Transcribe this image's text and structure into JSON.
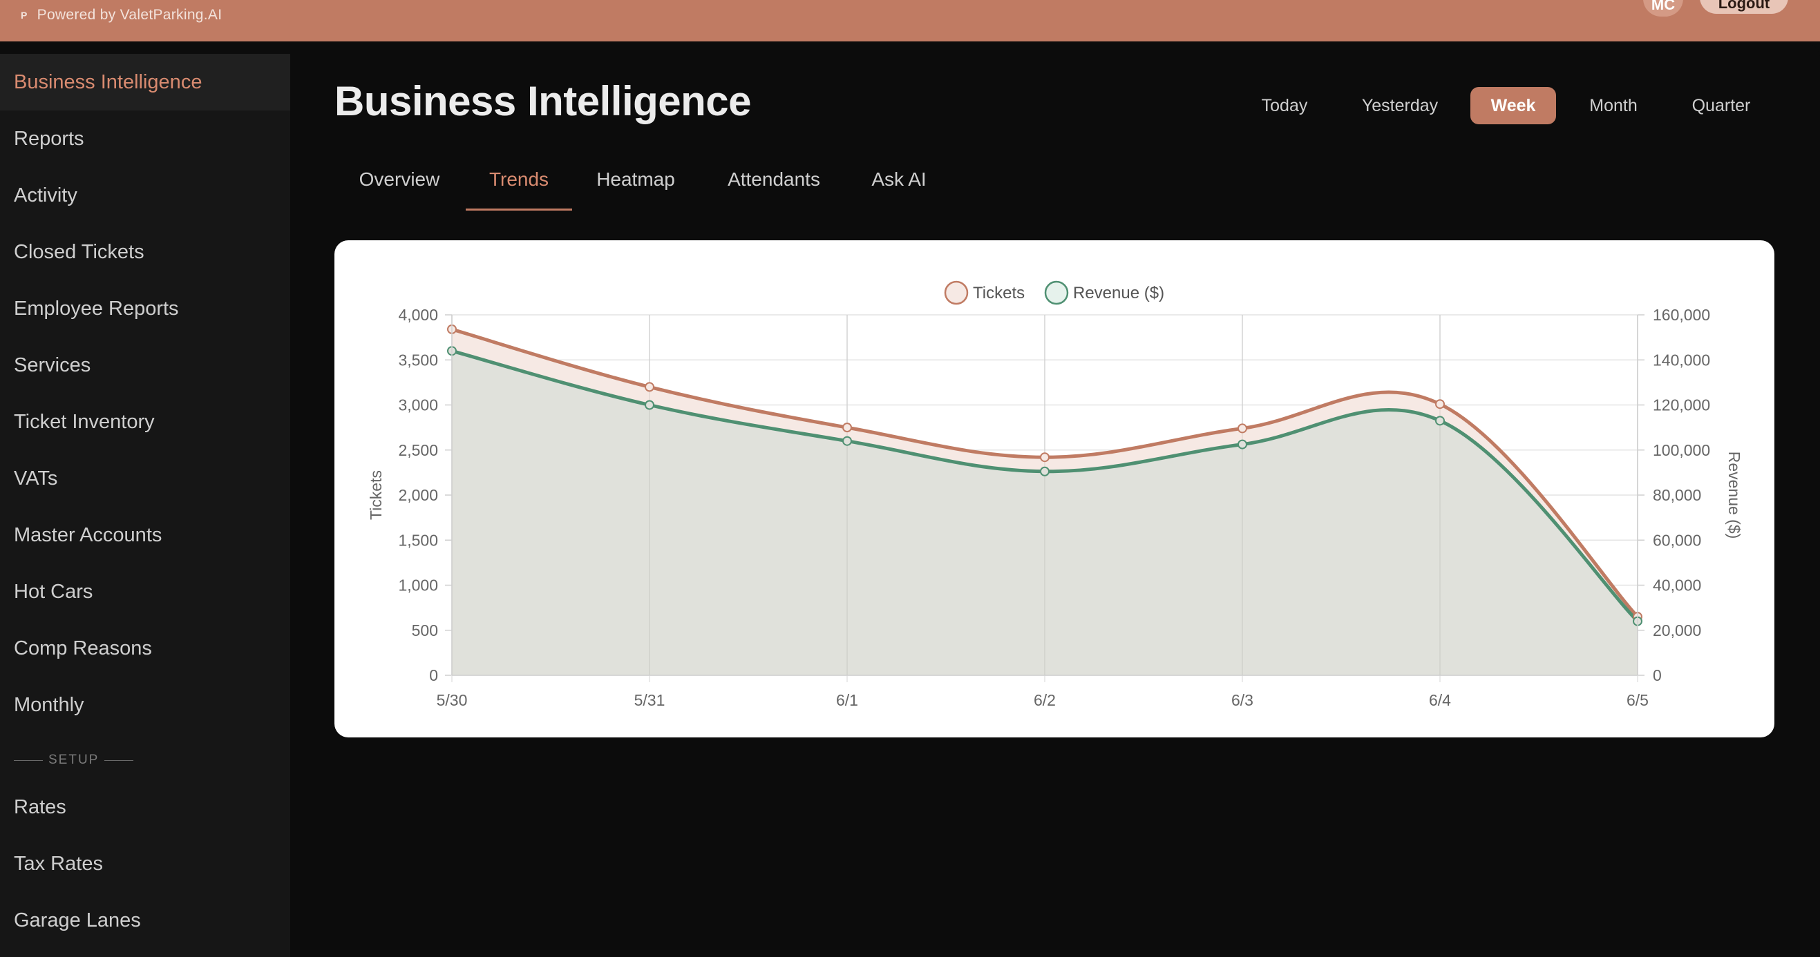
{
  "topbar": {
    "brand_glyph": "P",
    "powered_by": "Powered by ValetParking.AI",
    "avatar_initials": "MC",
    "logout_label": "Logout"
  },
  "sidebar": {
    "items": [
      {
        "label": "Business Intelligence",
        "active": true
      },
      {
        "label": "Reports"
      },
      {
        "label": "Activity"
      },
      {
        "label": "Closed Tickets"
      },
      {
        "label": "Employee Reports"
      },
      {
        "label": "Services"
      },
      {
        "label": "Ticket Inventory"
      },
      {
        "label": "VATs"
      },
      {
        "label": "Master Accounts"
      },
      {
        "label": "Hot Cars"
      },
      {
        "label": "Comp Reasons"
      },
      {
        "label": "Monthly"
      }
    ],
    "setup_heading": "SETUP",
    "setup_items": [
      {
        "label": "Rates"
      },
      {
        "label": "Tax Rates"
      },
      {
        "label": "Garage Lanes"
      }
    ]
  },
  "page": {
    "title": "Business Intelligence"
  },
  "ranges": [
    {
      "label": "Today"
    },
    {
      "label": "Yesterday"
    },
    {
      "label": "Week",
      "active": true
    },
    {
      "label": "Month"
    },
    {
      "label": "Quarter"
    }
  ],
  "tabs": [
    {
      "label": "Overview"
    },
    {
      "label": "Trends",
      "active": true
    },
    {
      "label": "Heatmap"
    },
    {
      "label": "Attendants"
    },
    {
      "label": "Ask AI"
    }
  ],
  "colors": {
    "accent": "#c07b63",
    "tickets_line": "#c07b63",
    "revenue_line": "#4f9072",
    "revenue_fill": "#e0e1db",
    "tickets_fill": "#f6e9e4"
  },
  "chart_data": {
    "type": "line",
    "categories": [
      "5/30",
      "5/31",
      "6/1",
      "6/2",
      "6/3",
      "6/4",
      "6/5"
    ],
    "series": [
      {
        "name": "Tickets",
        "axis": "left",
        "values": [
          3840,
          3200,
          2750,
          2420,
          2740,
          3010,
          650
        ]
      },
      {
        "name": "Revenue ($)",
        "axis": "right",
        "values": [
          144000,
          120000,
          104000,
          90500,
          102500,
          113000,
          24000
        ]
      }
    ],
    "ylabel": "Tickets",
    "y2label": "Revenue ($)",
    "ylim": [
      0,
      4000
    ],
    "y2lim": [
      0,
      160000
    ],
    "yticks": [
      "0",
      "500",
      "1,000",
      "1,500",
      "2,000",
      "2,500",
      "3,000",
      "3,500",
      "4,000"
    ],
    "y2ticks": [
      "0",
      "20,000",
      "40,000",
      "60,000",
      "80,000",
      "100,000",
      "120,000",
      "140,000",
      "160,000"
    ],
    "legend_position": "top",
    "grid": true,
    "filled": true,
    "smooth": true
  }
}
